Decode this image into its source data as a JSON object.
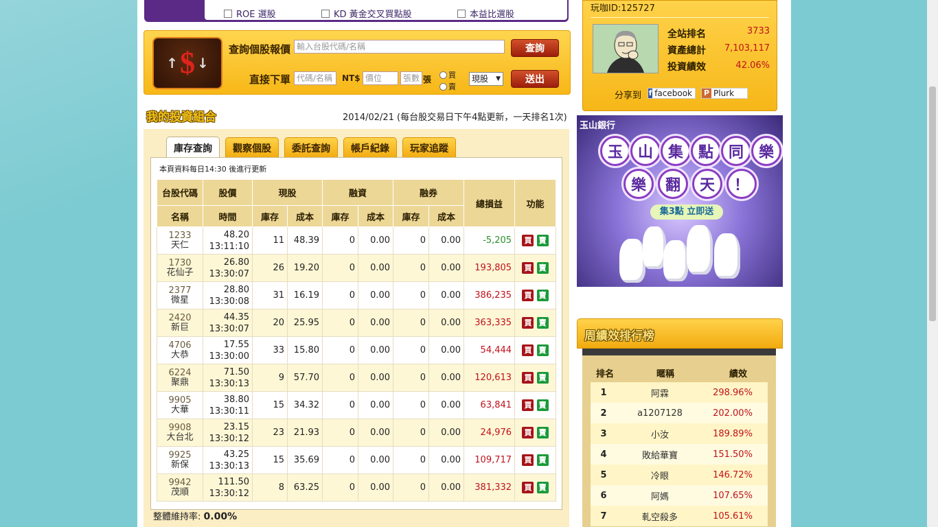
{
  "filters": {
    "items": [
      {
        "label": "ROE 選股"
      },
      {
        "label": "KD 黃金交叉買點股"
      },
      {
        "label": "本益比選股"
      }
    ]
  },
  "query": {
    "quote_label": "查詢個股報價",
    "quote_placeholder": "輸入台股代碼/名稱",
    "quote_button": "查詢",
    "order_label": "直接下單",
    "code_placeholder": "代碼/名稱",
    "currency": "NT$",
    "price_placeholder": "價位",
    "qty_placeholder": "張數",
    "unit": "張",
    "buy": "買",
    "sell": "賣",
    "type_selected": "現股",
    "submit": "送出"
  },
  "portfolio": {
    "title": "我的投資組合",
    "date_note": "2014/02/21 (每台股交易日下午4點更新，一天排名1次)",
    "tabs": [
      "庫存查詢",
      "觀察個股",
      "委託查詢",
      "帳戶紀錄",
      "玩家追蹤"
    ],
    "update_note": "本頁資料每日14:30 後進行更新",
    "headers": {
      "code": "台股代碼",
      "price": "股價",
      "cash": "現股",
      "margin": "融資",
      "short": "融券",
      "pnl": "總損益",
      "func": "功能",
      "name": "名稱",
      "time": "時間",
      "stock": "庫存",
      "cost": "成本"
    },
    "rows": [
      {
        "code": "1233",
        "name": "天仁",
        "price": "48.20",
        "time": "13:11:10",
        "q1": "11",
        "c1": "48.39",
        "q2": "0",
        "c2": "0.00",
        "q3": "0",
        "c3": "0.00",
        "pnl": "-5,205"
      },
      {
        "code": "1730",
        "name": "花仙子",
        "price": "26.80",
        "time": "13:30:07",
        "q1": "26",
        "c1": "19.20",
        "q2": "0",
        "c2": "0.00",
        "q3": "0",
        "c3": "0.00",
        "pnl": "193,805"
      },
      {
        "code": "2377",
        "name": "微星",
        "price": "28.80",
        "time": "13:30:08",
        "q1": "31",
        "c1": "16.19",
        "q2": "0",
        "c2": "0.00",
        "q3": "0",
        "c3": "0.00",
        "pnl": "386,235"
      },
      {
        "code": "2420",
        "name": "新巨",
        "price": "44.35",
        "time": "13:30:07",
        "q1": "20",
        "c1": "25.95",
        "q2": "0",
        "c2": "0.00",
        "q3": "0",
        "c3": "0.00",
        "pnl": "363,335"
      },
      {
        "code": "4706",
        "name": "大恭",
        "price": "17.55",
        "time": "13:30:00",
        "q1": "33",
        "c1": "15.80",
        "q2": "0",
        "c2": "0.00",
        "q3": "0",
        "c3": "0.00",
        "pnl": "54,444"
      },
      {
        "code": "6224",
        "name": "聚鼎",
        "price": "71.50",
        "time": "13:30:13",
        "q1": "9",
        "c1": "57.70",
        "q2": "0",
        "c2": "0.00",
        "q3": "0",
        "c3": "0.00",
        "pnl": "120,613"
      },
      {
        "code": "9905",
        "name": "大華",
        "price": "38.80",
        "time": "13:30:11",
        "q1": "15",
        "c1": "34.32",
        "q2": "0",
        "c2": "0.00",
        "q3": "0",
        "c3": "0.00",
        "pnl": "63,841"
      },
      {
        "code": "9908",
        "name": "大台北",
        "price": "23.15",
        "time": "13:30:12",
        "q1": "23",
        "c1": "21.93",
        "q2": "0",
        "c2": "0.00",
        "q3": "0",
        "c3": "0.00",
        "pnl": "24,976"
      },
      {
        "code": "9925",
        "name": "新保",
        "price": "43.25",
        "time": "13:30:13",
        "q1": "15",
        "c1": "35.69",
        "q2": "0",
        "c2": "0.00",
        "q3": "0",
        "c3": "0.00",
        "pnl": "109,717"
      },
      {
        "code": "9942",
        "name": "茂順",
        "price": "111.50",
        "time": "13:30:12",
        "q1": "8",
        "c1": "63.25",
        "q2": "0",
        "c2": "0.00",
        "q3": "0",
        "c3": "0.00",
        "pnl": "381,332"
      }
    ],
    "buy_label": "買",
    "sell_label": "賣",
    "maintenance_label": "整體維持率:",
    "maintenance_value": "0.00%"
  },
  "profile": {
    "id_text": "玩咖ID:125727",
    "rank_label": "全站排名",
    "rank_value": "3733",
    "assets_label": "資產總計",
    "assets_value": "7,103,117",
    "perf_label": "投資績效",
    "perf_value": "42.06%",
    "share_label": "分享到",
    "facebook": "facebook",
    "plurk": "Plurk"
  },
  "banner": {
    "bank": "玉山銀行",
    "row1": [
      "玉",
      "山",
      "集",
      "點",
      "同",
      "樂"
    ],
    "row2": [
      "樂",
      "翻",
      "天",
      "！"
    ],
    "sub": "集3點 立即送"
  },
  "ranking": {
    "title": "周績效排行榜",
    "headers": [
      "排名",
      "暱稱",
      "績效"
    ],
    "rows": [
      {
        "rank": "1",
        "name": "阿霖",
        "perf": "298.96%"
      },
      {
        "rank": "2",
        "name": "a1207128",
        "perf": "202.00%"
      },
      {
        "rank": "3",
        "name": "小汝",
        "perf": "189.89%"
      },
      {
        "rank": "4",
        "name": "敗給華寶",
        "perf": "151.50%"
      },
      {
        "rank": "5",
        "name": "冷眼",
        "perf": "146.72%"
      },
      {
        "rank": "6",
        "name": "阿媽",
        "perf": "107.65%"
      },
      {
        "rank": "7",
        "name": "軋空殺多",
        "perf": "105.61%"
      }
    ]
  },
  "colors": {
    "accent": "#f6b718",
    "brand_purple": "#5a2a86",
    "gain": "#c0111b",
    "loss": "#2a8f2a",
    "bg": "#7dcbd2"
  }
}
